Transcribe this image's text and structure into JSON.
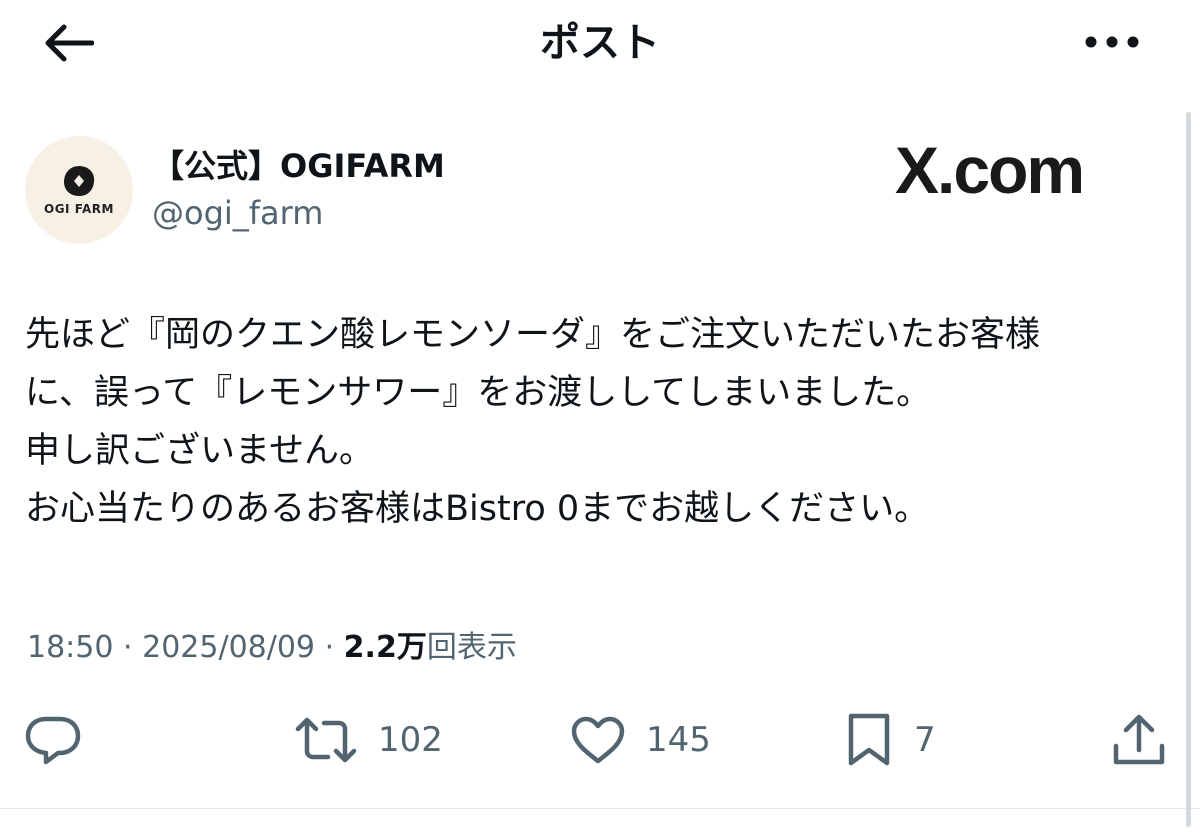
{
  "header": {
    "title": "ポスト"
  },
  "author": {
    "display_name": "【公式】OGIFARM",
    "handle": "@ogi_farm",
    "avatar_text": "OGI FARM"
  },
  "watermark": "X.com",
  "post": {
    "lines": [
      "先ほど『岡のクエン酸レモンソーダ』をご注文いただいたお客様",
      "に、誤って『レモンサワー』をお渡ししてしまいました。",
      "申し訳ございません。",
      "お心当たりのあるお客様はBistro 0までお越しください。"
    ]
  },
  "meta": {
    "time": "18:50",
    "separator": "·",
    "date": "2025/08/09",
    "views_count": "2.2万",
    "views_label": "回表示"
  },
  "actions": {
    "reply_icon": "reply-icon",
    "repost_icon": "repost-icon",
    "repost_count": "102",
    "like_icon": "heart-icon",
    "like_count": "145",
    "bookmark_icon": "bookmark-icon",
    "bookmark_count": "7",
    "share_icon": "share-icon"
  },
  "colors": {
    "text_primary": "#0f1419",
    "text_secondary": "#536471",
    "avatar_bg": "#f7f0e4",
    "divider": "#e6e9eb"
  }
}
